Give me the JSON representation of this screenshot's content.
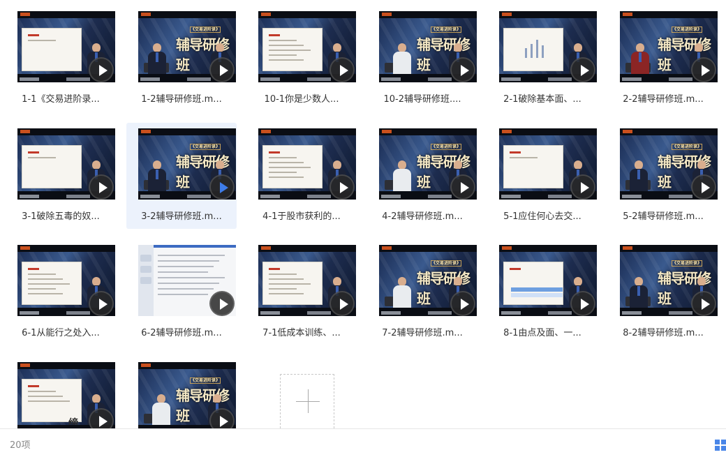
{
  "files": [
    {
      "name": "1-1《交易进阶录...",
      "thumb": "slide"
    },
    {
      "name": "1-2辅导研修班.m...",
      "thumb": "host"
    },
    {
      "name": "10-1你是少数人...",
      "thumb": "slide-list"
    },
    {
      "name": "10-2辅导研修班....",
      "thumb": "studio"
    },
    {
      "name": "2-1破除基本面、...",
      "thumb": "slide-chart"
    },
    {
      "name": "2-2辅导研修班.m...",
      "thumb": "studio-red"
    },
    {
      "name": "3-1破除五毒的奴...",
      "thumb": "slide"
    },
    {
      "name": "3-2辅导研修班.m...",
      "thumb": "host",
      "selected": true
    },
    {
      "name": "4-1于股市获利的...",
      "thumb": "slide-list"
    },
    {
      "name": "4-2辅导研修班.m...",
      "thumb": "studio"
    },
    {
      "name": "5-1应住何心去交...",
      "thumb": "slide"
    },
    {
      "name": "5-2辅导研修班.m...",
      "thumb": "host"
    },
    {
      "name": "6-1从能行之处入...",
      "thumb": "slide-list"
    },
    {
      "name": "6-2辅导研修班.m...",
      "thumb": "doc"
    },
    {
      "name": "7-1低成本训练、...",
      "thumb": "slide-list"
    },
    {
      "name": "7-2辅导研修班.m...",
      "thumb": "studio"
    },
    {
      "name": "8-1由点及面、一...",
      "thumb": "slide-table"
    },
    {
      "name": "8-2辅导研修班.m...",
      "thumb": "host"
    },
    {
      "name": "",
      "thumb": "slide-calli"
    },
    {
      "name": "",
      "thumb": "studio"
    }
  ],
  "thumb_logo": {
    "banner": "《交易进阶录》",
    "title": "辅导研修班"
  },
  "status": {
    "count": "20项"
  },
  "colors": {
    "accent": "#4a86e8",
    "selected_bg": "#ecf2fc",
    "text": "#333333",
    "muted": "#888888"
  },
  "icons": {
    "play": "play-icon",
    "add": "plus-icon",
    "view": "grid-view-icon"
  }
}
